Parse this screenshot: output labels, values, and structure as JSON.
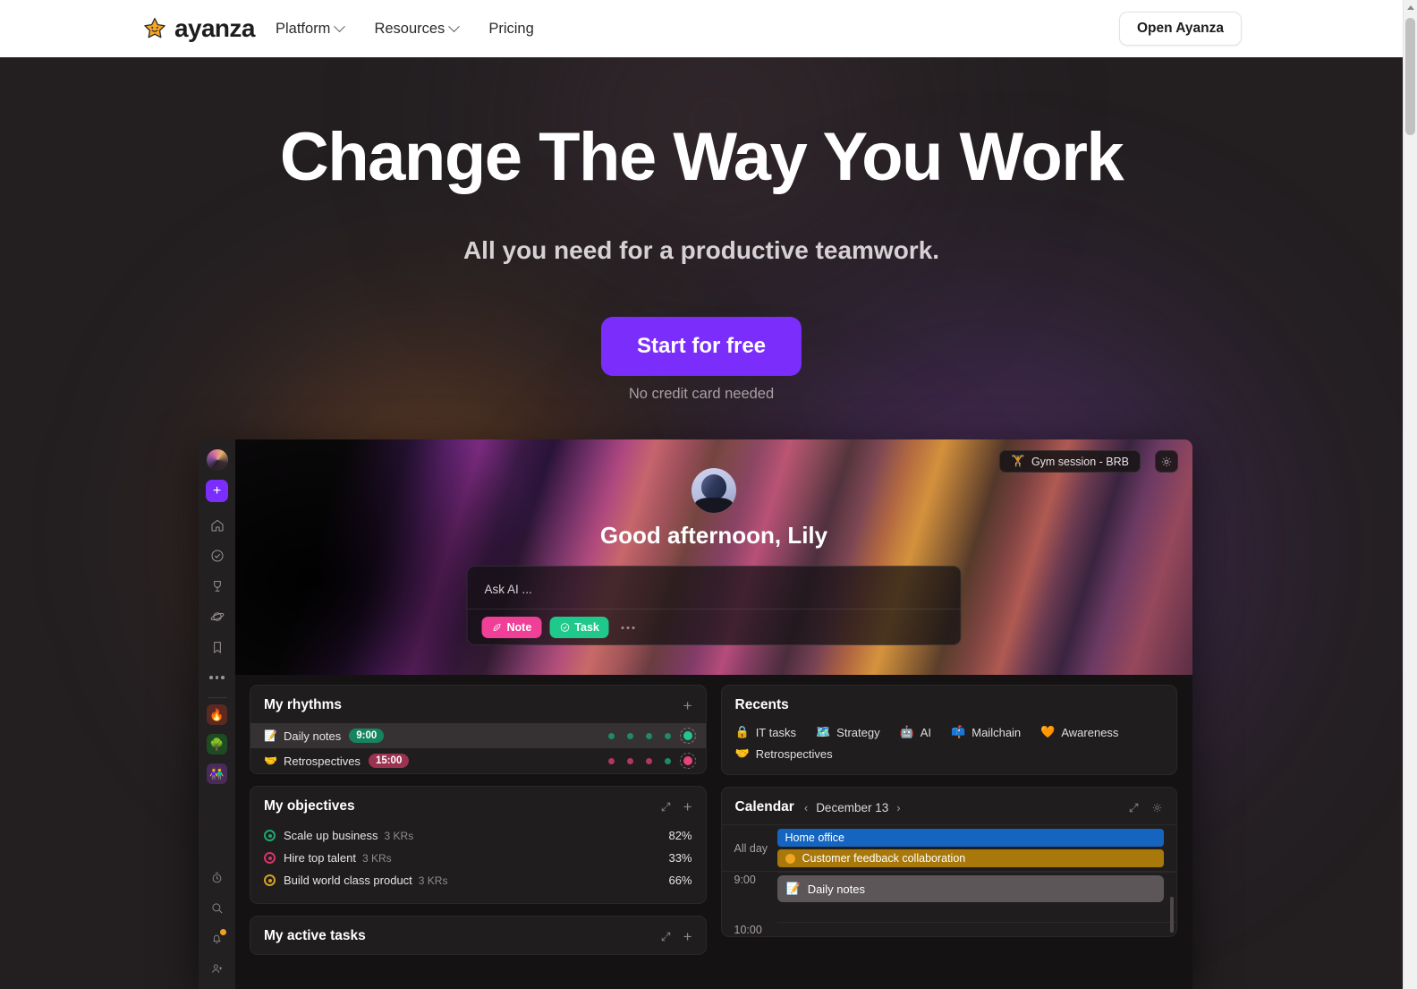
{
  "nav": {
    "brand": "ayanza",
    "brand_icon": "star-smiley-icon",
    "links": [
      {
        "label": "Platform",
        "has_dropdown": true
      },
      {
        "label": "Resources",
        "has_dropdown": true
      },
      {
        "label": "Pricing",
        "has_dropdown": false
      }
    ],
    "open_app_label": "Open Ayanza"
  },
  "hero": {
    "title": "Change The Way You Work",
    "subtitle": "All you need for a productive teamwork.",
    "cta_label": "Start for free",
    "cta_note": "No credit card needed",
    "cta_color": "#7b2dfc"
  },
  "app": {
    "sidebar": {
      "avatar": "user-avatar",
      "add_label": "+",
      "items": [
        {
          "name": "home-icon"
        },
        {
          "name": "tasks-check-icon"
        },
        {
          "name": "goals-trophy-icon"
        },
        {
          "name": "planet-icon"
        },
        {
          "name": "bookmark-icon"
        },
        {
          "name": "more-dots-icon"
        }
      ],
      "workspaces": [
        {
          "name": "workspace-fire",
          "emoji": "🔥",
          "color": "#5a2a22"
        },
        {
          "name": "workspace-tree",
          "emoji": "🌳",
          "color": "#1e4a24"
        },
        {
          "name": "workspace-people",
          "emoji": "👫",
          "color": "#4a2a5a"
        }
      ],
      "bottom": [
        {
          "name": "timer-icon"
        },
        {
          "name": "search-icon"
        },
        {
          "name": "notifications-bell-icon",
          "badge": true
        },
        {
          "name": "invite-person-icon"
        }
      ]
    },
    "banner": {
      "status_pill": {
        "emoji": "🏋️",
        "label": "Gym session - BRB"
      },
      "settings_icon": "gear-icon",
      "greeting": "Good afternoon, Lily",
      "ask_ai": {
        "placeholder": "Ask AI ...",
        "note_label": "Note",
        "task_label": "Task",
        "more_label": "...",
        "note_color": "#ef3f96",
        "task_color": "#1fc98b"
      }
    },
    "rhythms": {
      "title": "My rhythms",
      "add_label": "+",
      "rows": [
        {
          "emoji": "📝",
          "label": "Daily notes",
          "time": "9:00",
          "badge_color": "#16855e",
          "active": true,
          "dots": [
            "#1f8a63",
            "#1f8a63",
            "#1f8a63",
            "#1f8a63"
          ],
          "last_dot": "#1fc98b"
        },
        {
          "emoji": "🤝",
          "label": "Retrospectives",
          "time": "15:00",
          "badge_color": "#9b3350",
          "active": false,
          "dots": [
            "#b0385c",
            "#b0385c",
            "#b0385c",
            "#1f8a63"
          ],
          "last_dot": "#e8437a"
        }
      ]
    },
    "recents": {
      "title": "Recents",
      "items": [
        {
          "emoji": "🔒",
          "label": "IT tasks"
        },
        {
          "emoji": "🗺️",
          "label": "Strategy"
        },
        {
          "emoji": "🤖",
          "label": "AI"
        },
        {
          "emoji": "📫",
          "label": "Mailchain"
        },
        {
          "emoji": "🧡",
          "label": "Awareness"
        },
        {
          "emoji": "🤝",
          "label": "Retrospectives"
        }
      ]
    },
    "objectives": {
      "title": "My objectives",
      "expand_icon": "expand-icon",
      "add_label": "+",
      "rows": [
        {
          "label": "Scale up business",
          "krs": "3 KRs",
          "percent": "82%",
          "color": "#1fa86f"
        },
        {
          "label": "Hire top talent",
          "krs": "3 KRs",
          "percent": "33%",
          "color": "#d8346a"
        },
        {
          "label": "Build world class product",
          "krs": "3 KRs",
          "percent": "66%",
          "color": "#d8a020"
        }
      ]
    },
    "calendar": {
      "title": "Calendar",
      "prev_label": "‹",
      "next_label": "›",
      "date": "December 13",
      "expand_icon": "expand-icon",
      "settings_icon": "gear-icon",
      "allday_label": "All day",
      "allday_events": [
        {
          "label": "Home office",
          "color": "#1565c0",
          "has_dot": false
        },
        {
          "label": "Customer feedback collaboration",
          "color": "#a8780a",
          "has_dot": true
        }
      ],
      "hours": [
        {
          "time": "9:00",
          "event": {
            "emoji": "📝",
            "label": "Daily notes"
          }
        },
        {
          "time": "10:00",
          "event": null
        }
      ]
    },
    "active_tasks": {
      "title": "My active tasks",
      "expand_icon": "expand-icon",
      "add_label": "+"
    }
  }
}
